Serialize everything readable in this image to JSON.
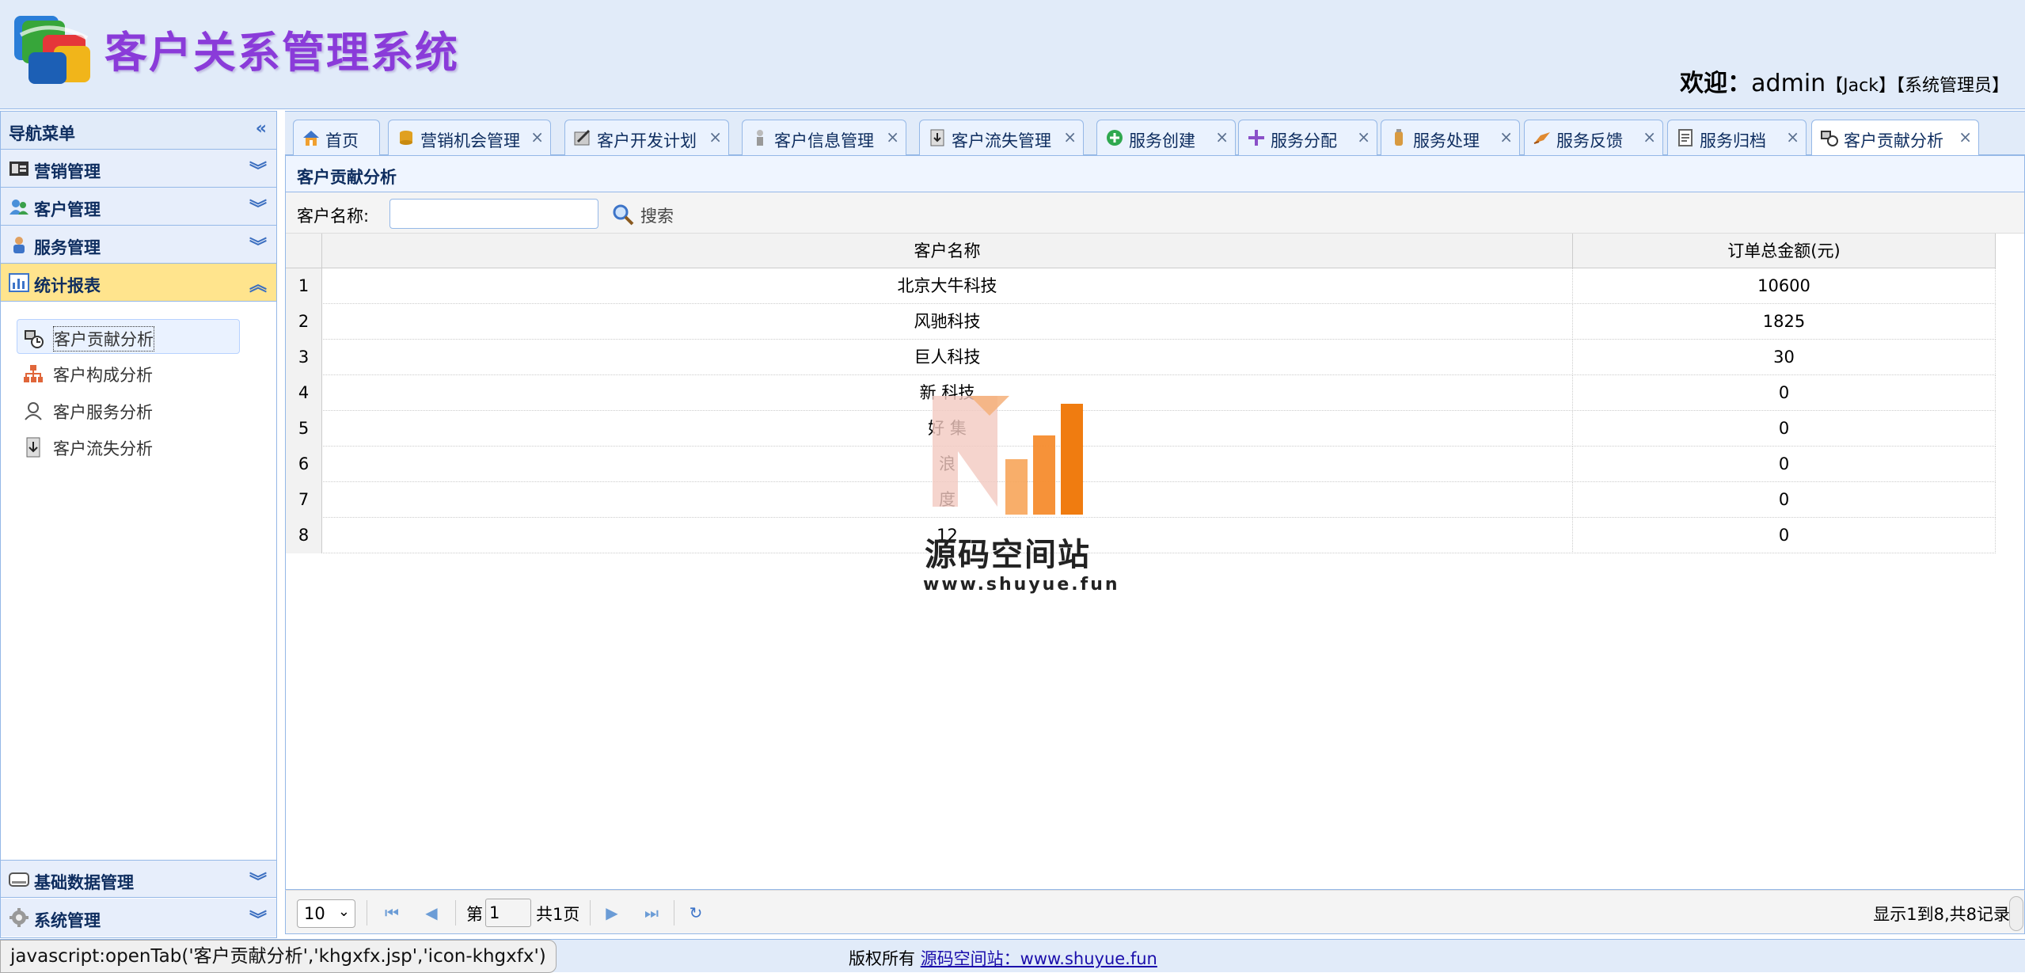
{
  "header": {
    "app_title": "客户关系管理系统",
    "welcome_prefix": "欢迎：",
    "username": "admin",
    "realname": "【Jack】",
    "role": "【系统管理员】"
  },
  "sidebar": {
    "title": "导航菜单",
    "groups": [
      {
        "label": "营销管理",
        "icon": "marketing-icon"
      },
      {
        "label": "客户管理",
        "icon": "customer-icon"
      },
      {
        "label": "服务管理",
        "icon": "service-icon"
      },
      {
        "label": "统计报表",
        "icon": "report-icon",
        "expanded": true
      }
    ],
    "report_items": [
      {
        "label": "客户贡献分析",
        "icon": "contribution-icon",
        "selected": true
      },
      {
        "label": "客户构成分析",
        "icon": "structure-icon"
      },
      {
        "label": "客户服务分析",
        "icon": "user-service-icon"
      },
      {
        "label": "客户流失分析",
        "icon": "loss-icon"
      }
    ],
    "bottom_groups": [
      {
        "label": "基础数据管理",
        "icon": "database-icon"
      },
      {
        "label": "系统管理",
        "icon": "settings-icon"
      }
    ]
  },
  "tabs": [
    {
      "label": "首页",
      "icon": "home-icon",
      "closable": false
    },
    {
      "label": "营销机会管理",
      "icon": "coins-icon"
    },
    {
      "label": "客户开发计划",
      "icon": "plan-icon"
    },
    {
      "label": "客户信息管理",
      "icon": "info-icon"
    },
    {
      "label": "客户流失管理",
      "icon": "loss-icon"
    },
    {
      "label": "服务创建",
      "icon": "add-icon"
    },
    {
      "label": "服务分配",
      "icon": "assign-icon"
    },
    {
      "label": "服务处理",
      "icon": "process-icon"
    },
    {
      "label": "服务反馈",
      "icon": "feedback-icon"
    },
    {
      "label": "服务归档",
      "icon": "archive-icon"
    },
    {
      "label": "客户贡献分析",
      "icon": "contribution-icon",
      "active": true
    }
  ],
  "tab_close": "×",
  "panel": {
    "title": "客户贡献分析",
    "search_label": "客户名称:",
    "search_value": "",
    "search_button": "搜索"
  },
  "grid": {
    "columns": [
      "客户名称",
      "订单总金额(元)"
    ],
    "rows": [
      {
        "n": "1",
        "name": "北京大牛科技",
        "amount": "10600"
      },
      {
        "n": "2",
        "name": "风驰科技",
        "amount": "1825"
      },
      {
        "n": "3",
        "name": "巨人科技",
        "amount": "30"
      },
      {
        "n": "4",
        "name": "新 科技",
        "amount": "0"
      },
      {
        "n": "5",
        "name": "好 集",
        "amount": "0"
      },
      {
        "n": "6",
        "name": "浪",
        "amount": "0"
      },
      {
        "n": "7",
        "name": "度",
        "amount": "0"
      },
      {
        "n": "8",
        "name": "12",
        "amount": "0"
      }
    ]
  },
  "pager": {
    "page_size": "10",
    "page_prefix": "第",
    "page_number": "1",
    "page_total": "共1页",
    "info": "显示1到8,共8记录"
  },
  "footer": {
    "status_url": "javascript:openTab('客户贡献分析','khgxfx.jsp','icon-khgxfx')",
    "copyright_prefix": "版权所有",
    "copyright_link": "源码空间站：www.shuyue.fun"
  },
  "watermark": {
    "name": "源码空间站",
    "url": "www.shuyue.fun"
  },
  "colors": {
    "header_bg": "#e1ebf9",
    "border": "#95b8e7",
    "active_group": "#ffe48d",
    "title_purple": "#8a3bd9"
  }
}
